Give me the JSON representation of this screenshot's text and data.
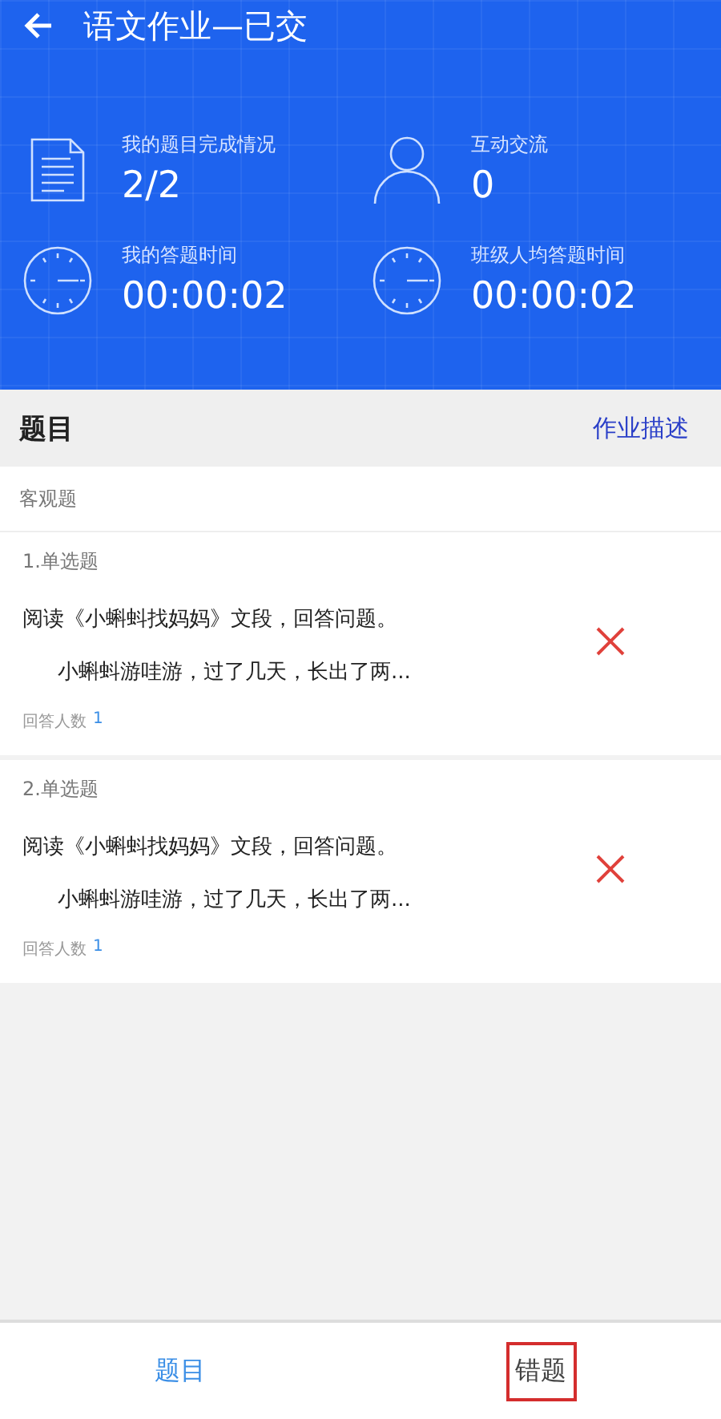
{
  "header": {
    "title": "语文作业—已交"
  },
  "stats": [
    {
      "kind": "document",
      "label": "我的题目完成情况",
      "value": "2/2"
    },
    {
      "kind": "person",
      "label": "互动交流",
      "value": "0"
    },
    {
      "kind": "clock",
      "label": "我的答题时间",
      "value": "00:00:02"
    },
    {
      "kind": "clock",
      "label": "班级人均答题时间",
      "value": "00:00:02"
    }
  ],
  "section": {
    "title": "题目",
    "link": "作业描述"
  },
  "group": "客观题",
  "questions": [
    {
      "type": "1.单选题",
      "prompt": "阅读《小蝌蚪找妈妈》文段，回答问题。",
      "excerpt": "小蝌蚪游哇游，过了几天，长出了两...",
      "correct": false,
      "answer_label": "回答人数",
      "answer_count": "1"
    },
    {
      "type": "2.单选题",
      "prompt": "阅读《小蝌蚪找妈妈》文段，回答问题。",
      "excerpt": "小蝌蚪游哇游，过了几天，长出了两...",
      "correct": false,
      "answer_label": "回答人数",
      "answer_count": "1"
    }
  ],
  "tabs": [
    {
      "label": "题目",
      "selected": true,
      "highlighted": false
    },
    {
      "label": "错题",
      "selected": false,
      "highlighted": true
    }
  ]
}
